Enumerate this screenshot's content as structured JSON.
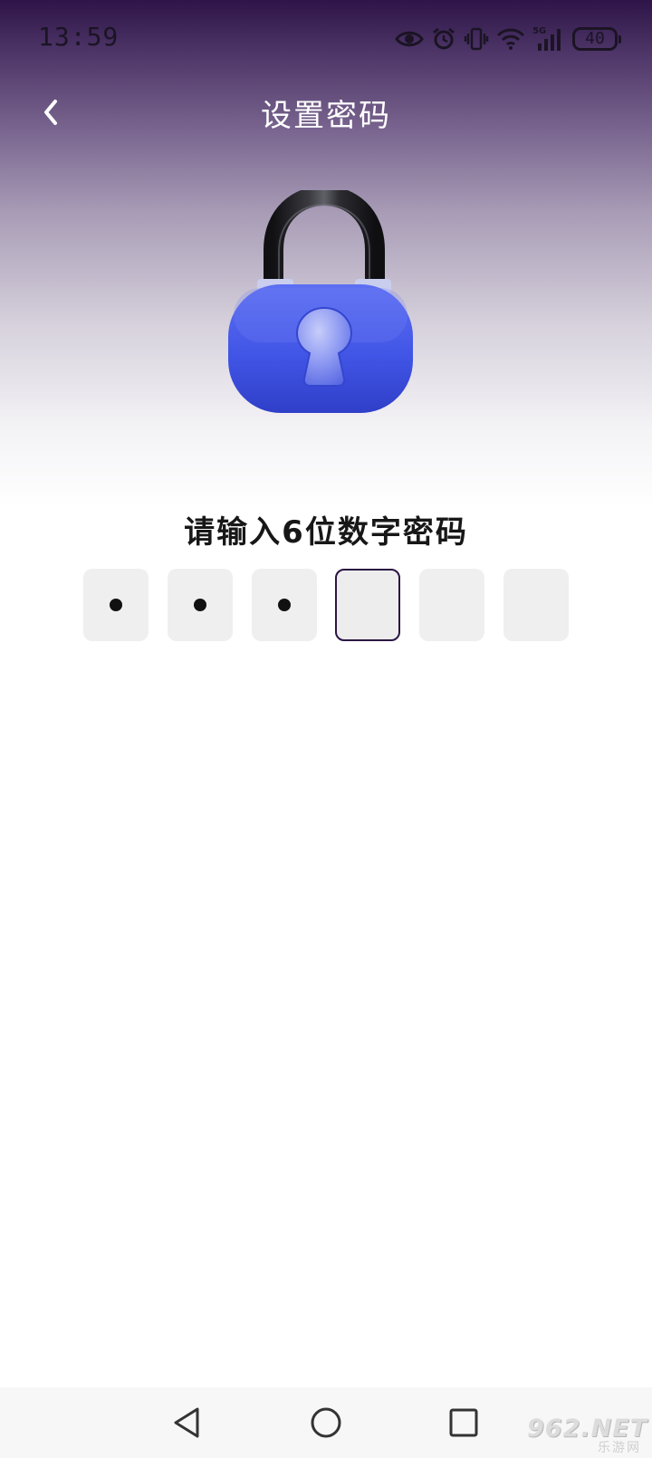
{
  "status_bar": {
    "time": "13:59",
    "battery": "40",
    "network": "5G",
    "icons": [
      "eye-icon",
      "alarm-icon",
      "vibrate-icon",
      "wifi-icon",
      "signal-icon",
      "battery-icon"
    ]
  },
  "header": {
    "title": "设置密码",
    "back_icon": "chevron-left-icon"
  },
  "illustration": {
    "icon": "padlock-icon",
    "lock_color": "#4a5be8",
    "shackle_color": "#1d1d20"
  },
  "password": {
    "prompt": "请输入6位数字密码",
    "length": 6,
    "filled_count": 3,
    "active_index": 3
  },
  "nav_bar": {
    "back_icon": "triangle-back-icon",
    "home_icon": "circle-home-icon",
    "recent_icon": "square-recent-icon"
  },
  "watermark": {
    "main": "962.NET",
    "sub": "乐游网"
  },
  "colors": {
    "header_gradient_top": "#2e1448",
    "active_box_border": "#2b1642",
    "input_box_bg": "#efefef"
  }
}
